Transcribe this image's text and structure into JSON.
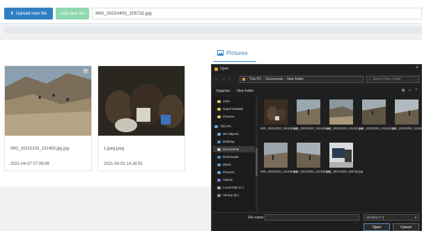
{
  "toolbar": {
    "upload_label": "Upload new file",
    "add_label": "Add new file",
    "file_value": "IMG_20210403_155732.jpg"
  },
  "gallery": {
    "title": "Pictures",
    "cards": [
      {
        "name": "IMG_20210203_131459.jpg.jpg",
        "date": "2021-04-07 07:09:06"
      },
      {
        "name": "1.jpeg.jpeg",
        "date": "2021-04-03 14:28:55"
      }
    ]
  },
  "dialog": {
    "title": "Open",
    "path": [
      "This PC",
      "Documents",
      "New folder"
    ],
    "search_placeholder": "Search New folder",
    "organize": "Organize",
    "new_folder": "New folder",
    "tree": [
      "John",
      "Nayef Shabab",
      "Pictures",
      "This PC",
      "3D Objects",
      "Desktop",
      "Documents",
      "Downloads",
      "Music",
      "Pictures",
      "Videos",
      "Local Disk (C:)",
      "Ventoy (D:)"
    ],
    "files": [
      "IMG_20210203_131458.jpg",
      "IMG_20210203_131459.jpg",
      "IMG_20210203_131461.jpg",
      "IMG_20210203_131462.jpg",
      "IMG_20210203_131463.jpg",
      "IMG_20210203_131465.jpg",
      "IMG_20210203_131466.jpg",
      "IMG_20210403_155732.jpg"
    ],
    "file_name_label": "File name:",
    "file_type": "All Files (*.*)",
    "open_label": "Open",
    "cancel_label": "Cancel"
  }
}
